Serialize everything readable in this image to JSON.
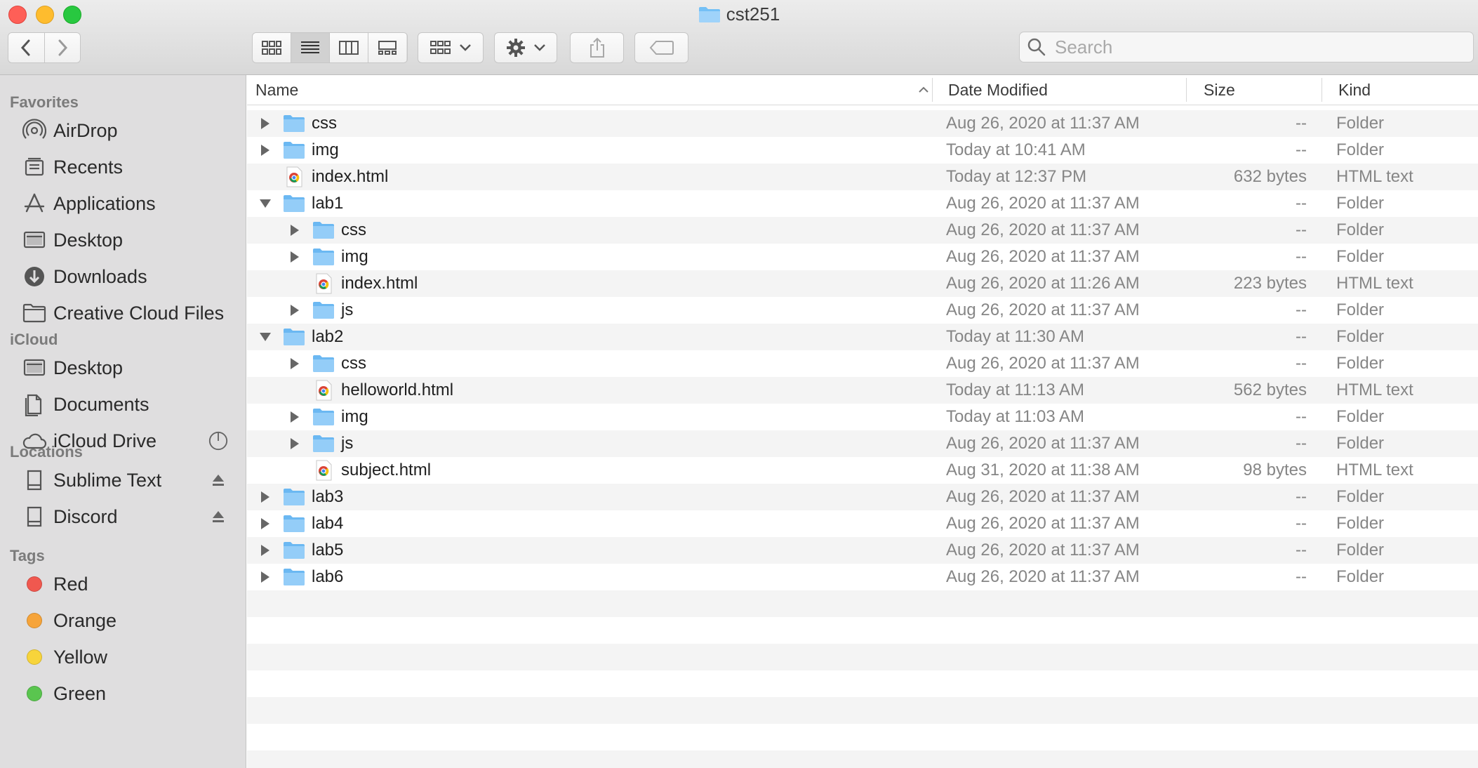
{
  "window": {
    "title": "cst251",
    "traffic_lights": [
      "close",
      "minimize",
      "zoom"
    ],
    "colors": {
      "close": "#fe5f57",
      "minimize": "#febc2e",
      "zoom": "#28c840"
    }
  },
  "toolbar": {
    "back_icon": "chevron-left-icon",
    "forward_icon": "chevron-right-icon",
    "view_modes": [
      "icon-view",
      "list-view",
      "column-view",
      "gallery-view"
    ],
    "active_view": "list-view",
    "group_icon": "group-grid-icon",
    "action_icon": "gear-icon",
    "share_icon": "share-icon",
    "tag_icon": "tag-icon",
    "search_placeholder": "Search"
  },
  "sidebar": {
    "sections": [
      {
        "title": "Favorites",
        "items": [
          {
            "label": "AirDrop",
            "icon": "airdrop-icon"
          },
          {
            "label": "Recents",
            "icon": "recents-icon"
          },
          {
            "label": "Applications",
            "icon": "applications-icon"
          },
          {
            "label": "Desktop",
            "icon": "desktop-icon"
          },
          {
            "label": "Downloads",
            "icon": "downloads-icon"
          },
          {
            "label": "Creative Cloud Files",
            "icon": "folder-icon"
          }
        ]
      },
      {
        "title": "iCloud",
        "items": [
          {
            "label": "Desktop",
            "icon": "desktop-icon"
          },
          {
            "label": "Documents",
            "icon": "documents-icon"
          },
          {
            "label": "iCloud Drive",
            "icon": "icloud-icon",
            "accessory": "sync-progress-icon"
          }
        ]
      },
      {
        "title": "Locations",
        "items": [
          {
            "label": "Sublime Text",
            "icon": "disk-icon",
            "accessory": "eject-icon"
          },
          {
            "label": "Discord",
            "icon": "disk-icon",
            "accessory": "eject-icon"
          }
        ]
      },
      {
        "title": "Tags",
        "items": [
          {
            "label": "Red",
            "color": "#f0584f"
          },
          {
            "label": "Orange",
            "color": "#f6a43a"
          },
          {
            "label": "Yellow",
            "color": "#f7d43b"
          },
          {
            "label": "Green",
            "color": "#5ac54f"
          }
        ]
      }
    ]
  },
  "columns": {
    "name": "Name",
    "date": "Date Modified",
    "size": "Size",
    "kind": "Kind"
  },
  "files": [
    {
      "name": "css",
      "date": "Aug 26, 2020 at 11:37 AM",
      "size": "--",
      "kind": "Folder",
      "type": "folder",
      "depth": 0,
      "expanded": false
    },
    {
      "name": "img",
      "date": "Today at 10:41 AM",
      "size": "--",
      "kind": "Folder",
      "type": "folder",
      "depth": 0,
      "expanded": false
    },
    {
      "name": "index.html",
      "date": "Today at 12:37 PM",
      "size": "632 bytes",
      "kind": "HTML text",
      "type": "html",
      "depth": 0
    },
    {
      "name": "lab1",
      "date": "Aug 26, 2020 at 11:37 AM",
      "size": "--",
      "kind": "Folder",
      "type": "folder",
      "depth": 0,
      "expanded": true
    },
    {
      "name": "css",
      "date": "Aug 26, 2020 at 11:37 AM",
      "size": "--",
      "kind": "Folder",
      "type": "folder",
      "depth": 1,
      "expanded": false
    },
    {
      "name": "img",
      "date": "Aug 26, 2020 at 11:37 AM",
      "size": "--",
      "kind": "Folder",
      "type": "folder",
      "depth": 1,
      "expanded": false
    },
    {
      "name": "index.html",
      "date": "Aug 26, 2020 at 11:26 AM",
      "size": "223 bytes",
      "kind": "HTML text",
      "type": "html",
      "depth": 1
    },
    {
      "name": "js",
      "date": "Aug 26, 2020 at 11:37 AM",
      "size": "--",
      "kind": "Folder",
      "type": "folder",
      "depth": 1,
      "expanded": false
    },
    {
      "name": "lab2",
      "date": "Today at 11:30 AM",
      "size": "--",
      "kind": "Folder",
      "type": "folder",
      "depth": 0,
      "expanded": true
    },
    {
      "name": "css",
      "date": "Aug 26, 2020 at 11:37 AM",
      "size": "--",
      "kind": "Folder",
      "type": "folder",
      "depth": 1,
      "expanded": false
    },
    {
      "name": "helloworld.html",
      "date": "Today at 11:13 AM",
      "size": "562 bytes",
      "kind": "HTML text",
      "type": "html",
      "depth": 1
    },
    {
      "name": "img",
      "date": "Today at 11:03 AM",
      "size": "--",
      "kind": "Folder",
      "type": "folder",
      "depth": 1,
      "expanded": false
    },
    {
      "name": "js",
      "date": "Aug 26, 2020 at 11:37 AM",
      "size": "--",
      "kind": "Folder",
      "type": "folder",
      "depth": 1,
      "expanded": false
    },
    {
      "name": "subject.html",
      "date": "Aug 31, 2020 at 11:38 AM",
      "size": "98 bytes",
      "kind": "HTML text",
      "type": "html",
      "depth": 1
    },
    {
      "name": "lab3",
      "date": "Aug 26, 2020 at 11:37 AM",
      "size": "--",
      "kind": "Folder",
      "type": "folder",
      "depth": 0,
      "expanded": false
    },
    {
      "name": "lab4",
      "date": "Aug 26, 2020 at 11:37 AM",
      "size": "--",
      "kind": "Folder",
      "type": "folder",
      "depth": 0,
      "expanded": false
    },
    {
      "name": "lab5",
      "date": "Aug 26, 2020 at 11:37 AM",
      "size": "--",
      "kind": "Folder",
      "type": "folder",
      "depth": 0,
      "expanded": false
    },
    {
      "name": "lab6",
      "date": "Aug 26, 2020 at 11:37 AM",
      "size": "--",
      "kind": "Folder",
      "type": "folder",
      "depth": 0,
      "expanded": false
    }
  ]
}
